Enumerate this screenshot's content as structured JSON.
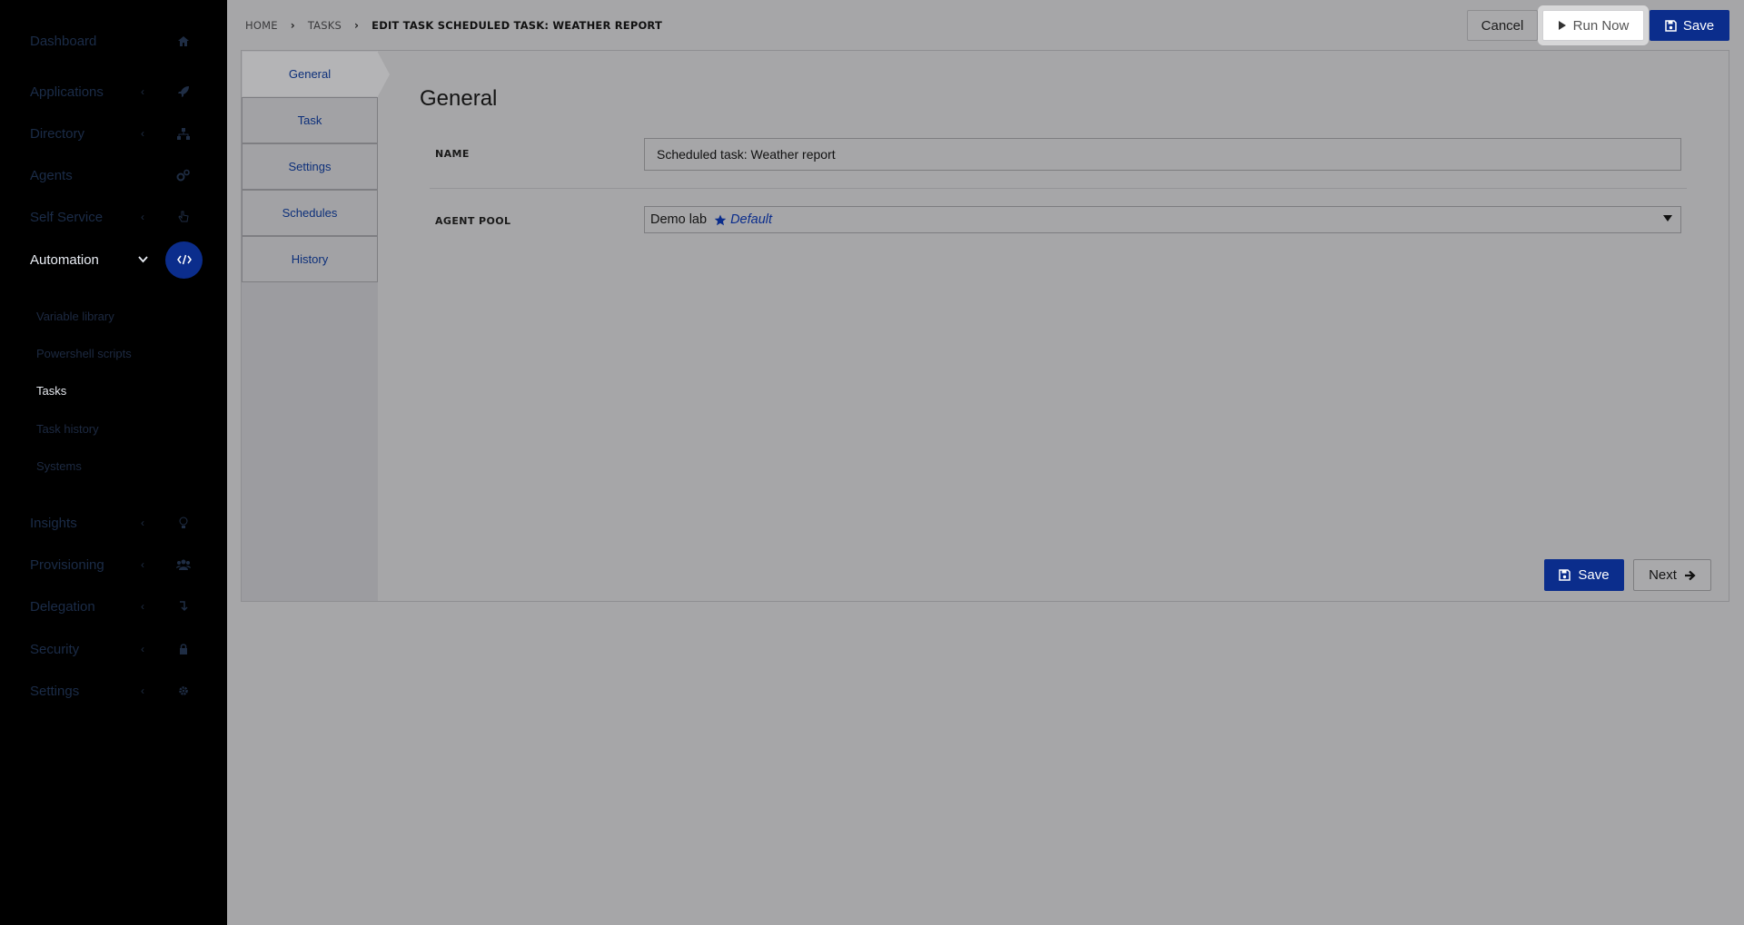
{
  "sidebar": {
    "items": [
      {
        "label": "Dashboard",
        "icon": "home-icon",
        "has_chevron": false
      },
      {
        "label": "Applications",
        "icon": "rocket-icon",
        "has_chevron": true
      },
      {
        "label": "Directory",
        "icon": "sitemap-icon",
        "has_chevron": true
      },
      {
        "label": "Agents",
        "icon": "cogs-icon",
        "has_chevron": false
      },
      {
        "label": "Self Service",
        "icon": "hand-pointer-icon",
        "has_chevron": true
      },
      {
        "label": "Automation",
        "icon": "code-icon",
        "has_chevron": true,
        "active": true
      },
      {
        "label": "Insights",
        "icon": "lightbulb-icon",
        "has_chevron": true
      },
      {
        "label": "Provisioning",
        "icon": "users-icon",
        "has_chevron": true
      },
      {
        "label": "Delegation",
        "icon": "level-down-icon",
        "has_chevron": true
      },
      {
        "label": "Security",
        "icon": "lock-icon",
        "has_chevron": true
      },
      {
        "label": "Settings",
        "icon": "gear-icon",
        "has_chevron": true
      }
    ],
    "automation_sub": [
      {
        "label": "Variable library"
      },
      {
        "label": "Powershell scripts"
      },
      {
        "label": "Tasks",
        "active": true
      },
      {
        "label": "Task history"
      },
      {
        "label": "Systems"
      }
    ]
  },
  "breadcrumb": {
    "home": "HOME",
    "tasks": "TASKS",
    "current": "EDIT TASK SCHEDULED TASK: WEATHER REPORT"
  },
  "header_actions": {
    "cancel_label": "Cancel",
    "run_now_label": "Run Now",
    "save_label": "Save"
  },
  "tabs": [
    {
      "label": "General",
      "active": true
    },
    {
      "label": "Task"
    },
    {
      "label": "Settings"
    },
    {
      "label": "Schedules"
    },
    {
      "label": "History"
    }
  ],
  "form": {
    "section_title": "General",
    "name_label": "NAME",
    "name_value": "Scheduled task: Weather report",
    "agent_pool_label": "AGENT POOL",
    "agent_pool_value": "Demo lab",
    "agent_pool_badge": "Default"
  },
  "footer_actions": {
    "save_label": "Save",
    "next_label": "Next"
  },
  "colors": {
    "accent": "#0b2d8c",
    "sidebar_bg": "#000000",
    "overlay_bg": "#a6a6a8"
  }
}
